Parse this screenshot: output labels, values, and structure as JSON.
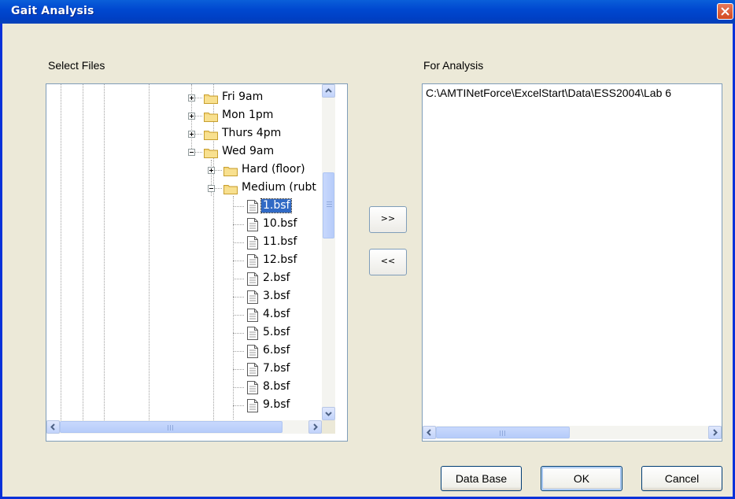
{
  "window": {
    "title": "Gait Analysis"
  },
  "select_files": {
    "label": "Select Files"
  },
  "for_analysis": {
    "label": "For Analysis",
    "items": [
      "C:\\AMTINetForce\\ExcelStart\\Data\\ESS2004\\Lab 6"
    ]
  },
  "tree": {
    "folders": [
      "Fri 9am",
      "Mon 1pm",
      "Thurs 4pm",
      "Wed 9am"
    ],
    "subfolders": [
      "Hard (floor)",
      "Medium (rubt"
    ],
    "files": [
      "1.bsf",
      "10.bsf",
      "11.bsf",
      "12.bsf",
      "2.bsf",
      "3.bsf",
      "4.bsf",
      "5.bsf",
      "6.bsf",
      "7.bsf",
      "8.bsf",
      "9.bsf"
    ],
    "selected_file": "1.bsf"
  },
  "buttons": {
    "add": ">>",
    "remove": "<<",
    "database": "Data Base",
    "ok": "OK",
    "cancel": "Cancel"
  },
  "colors": {
    "title_bar": "#0048d0",
    "selection": "#316ac5",
    "dialog_bg": "#ece9d8"
  }
}
